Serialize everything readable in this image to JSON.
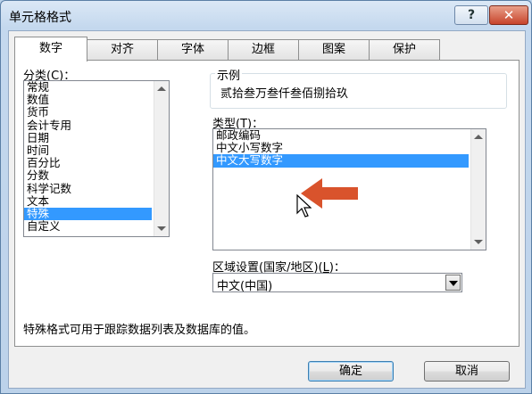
{
  "window": {
    "title": "单元格格式",
    "help_label": "?",
    "close_label": "✕"
  },
  "tabs": [
    {
      "label": "数字",
      "active": true
    },
    {
      "label": "对齐",
      "active": false
    },
    {
      "label": "字体",
      "active": false
    },
    {
      "label": "边框",
      "active": false
    },
    {
      "label": "图案",
      "active": false
    },
    {
      "label": "保护",
      "active": false
    }
  ],
  "category": {
    "label_pre": "分类(",
    "label_key": "C",
    "label_post": ")：",
    "items": [
      "常规",
      "数值",
      "货币",
      "会计专用",
      "日期",
      "时间",
      "百分比",
      "分数",
      "科学记数",
      "文本",
      "特殊",
      "自定义"
    ],
    "selected": "特殊"
  },
  "sample": {
    "label": "示例",
    "value": "贰拾叁万叁仟叁佰捌拾玖"
  },
  "type": {
    "label_pre": "类型(",
    "label_key": "T",
    "label_post": ")：",
    "items": [
      "邮政编码",
      "中文小写数字",
      "中文大写数字"
    ],
    "selected": "中文大写数字"
  },
  "locale": {
    "label_pre": "区域设置(国家/地区)(",
    "label_key": "L",
    "label_post": ")：",
    "value": "中文(中国)"
  },
  "description": "特殊格式可用于跟踪数据列表及数据库的值。",
  "buttons": {
    "ok": "确定",
    "cancel": "取消"
  },
  "colors": {
    "selection": "#3399ff",
    "annotation_arrow": "#d9532c"
  }
}
